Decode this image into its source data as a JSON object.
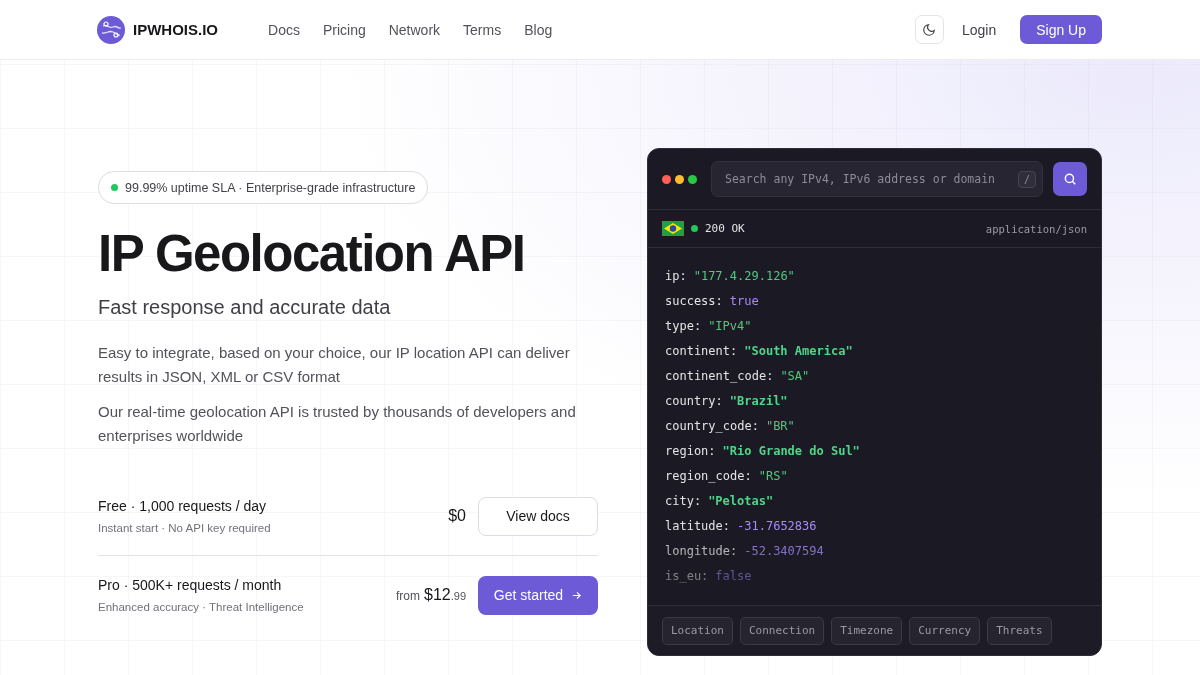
{
  "header": {
    "brand": "IPWHOIS.IO",
    "nav": [
      {
        "label": "Docs"
      },
      {
        "label": "Pricing"
      },
      {
        "label": "Network"
      },
      {
        "label": "Terms"
      },
      {
        "label": "Blog"
      }
    ],
    "login": "Login",
    "signup": "Sign Up"
  },
  "hero": {
    "badge": "99.99% uptime SLA · Enterprise-grade infrastructure",
    "title": "IP Geolocation API",
    "subtitle": "Fast response and accurate data",
    "paragraphs": [
      "Easy to integrate, based on your choice, our IP location API can deliver results in JSON, XML or CSV format",
      "Our real-time geolocation API is trusted by thousands of developers and enterprises worldwide"
    ],
    "plans": [
      {
        "name": "Free · 1,000 requests / day",
        "note": "Instant start · No API key required",
        "price": "$0",
        "button": "View docs",
        "kind": "outline"
      },
      {
        "name": "Pro · 500K+ requests / month",
        "note": "Enhanced accuracy · Threat Intelligence",
        "price_prefix": "from",
        "price": "$12",
        "price_cents": ".99",
        "button": "Get started",
        "kind": "primary"
      }
    ]
  },
  "console": {
    "search": {
      "placeholder": "Search any IPv4, IPv6 address or domain",
      "shortcut": "/"
    },
    "status": "200 OK",
    "content_type": "application/json",
    "lines": [
      {
        "key": "ip:",
        "value": "\"177.4.29.126\"",
        "kind": "string"
      },
      {
        "key": "success:",
        "value": "true",
        "kind": "literal"
      },
      {
        "key": "type:",
        "value": "\"IPv4\"",
        "kind": "string"
      },
      {
        "key": "continent:",
        "value": "\"South America\"",
        "kind": "strong"
      },
      {
        "key": "continent_code:",
        "value": "\"SA\"",
        "kind": "string"
      },
      {
        "key": "country:",
        "value": "\"Brazil\"",
        "kind": "strong"
      },
      {
        "key": "country_code:",
        "value": "\"BR\"",
        "kind": "string"
      },
      {
        "key": "region:",
        "value": "\"Rio Grande do Sul\"",
        "kind": "strong"
      },
      {
        "key": "region_code:",
        "value": "\"RS\"",
        "kind": "string"
      },
      {
        "key": "city:",
        "value": "\"Pelotas\"",
        "kind": "strong"
      },
      {
        "key": "latitude:",
        "value": "-31.7652836",
        "kind": "literal"
      },
      {
        "key": "longitude:",
        "value": "-52.3407594",
        "kind": "literal"
      },
      {
        "key": "is_eu:",
        "value": "false",
        "kind": "literal"
      }
    ],
    "tabs": [
      {
        "label": "Location"
      },
      {
        "label": "Connection"
      },
      {
        "label": "Timezone"
      },
      {
        "label": "Currency"
      },
      {
        "label": "Threats"
      }
    ]
  }
}
